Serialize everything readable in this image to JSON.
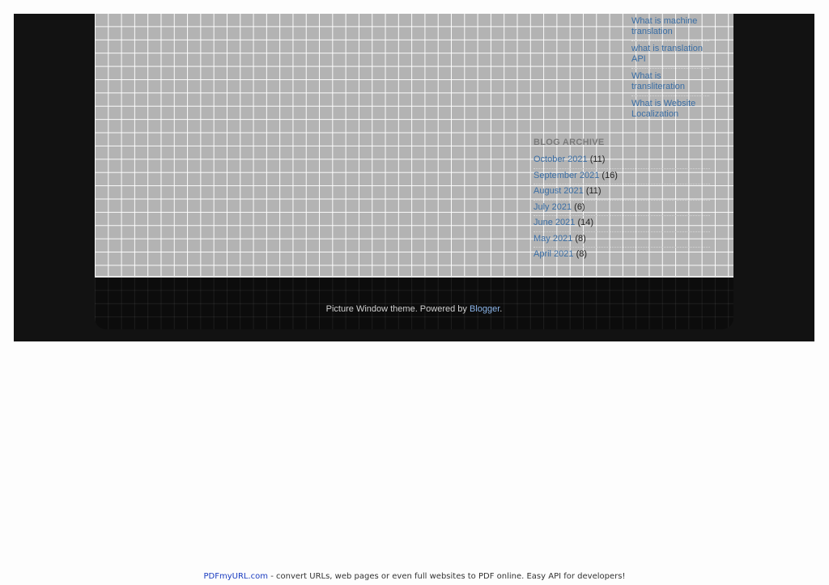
{
  "labels": [
    "What is machine translation",
    "what is translation API",
    "What is transliteration",
    "What is Website Localization"
  ],
  "archive": {
    "title": "BLOG ARCHIVE",
    "items": [
      {
        "month": "October 2021",
        "count": "(11)"
      },
      {
        "month": "September 2021",
        "count": "(16)"
      },
      {
        "month": "August 2021",
        "count": "(11)"
      },
      {
        "month": "July 2021",
        "count": "(6)"
      },
      {
        "month": "June 2021",
        "count": "(14)"
      },
      {
        "month": "May 2021",
        "count": "(8)"
      },
      {
        "month": "April 2021",
        "count": "(8)"
      }
    ]
  },
  "footer": {
    "prefix": "Picture Window theme. Powered by",
    "link": "Blogger",
    "suffix": "."
  },
  "banner": {
    "link": "PDFmyURL.com",
    "text": " - convert URLs, web pages or even full websites to PDF online. Easy API for developers!"
  },
  "colors": {
    "page_background": "#121212",
    "content_grid": "#b3b3b3",
    "link": "#3a6ea5"
  }
}
